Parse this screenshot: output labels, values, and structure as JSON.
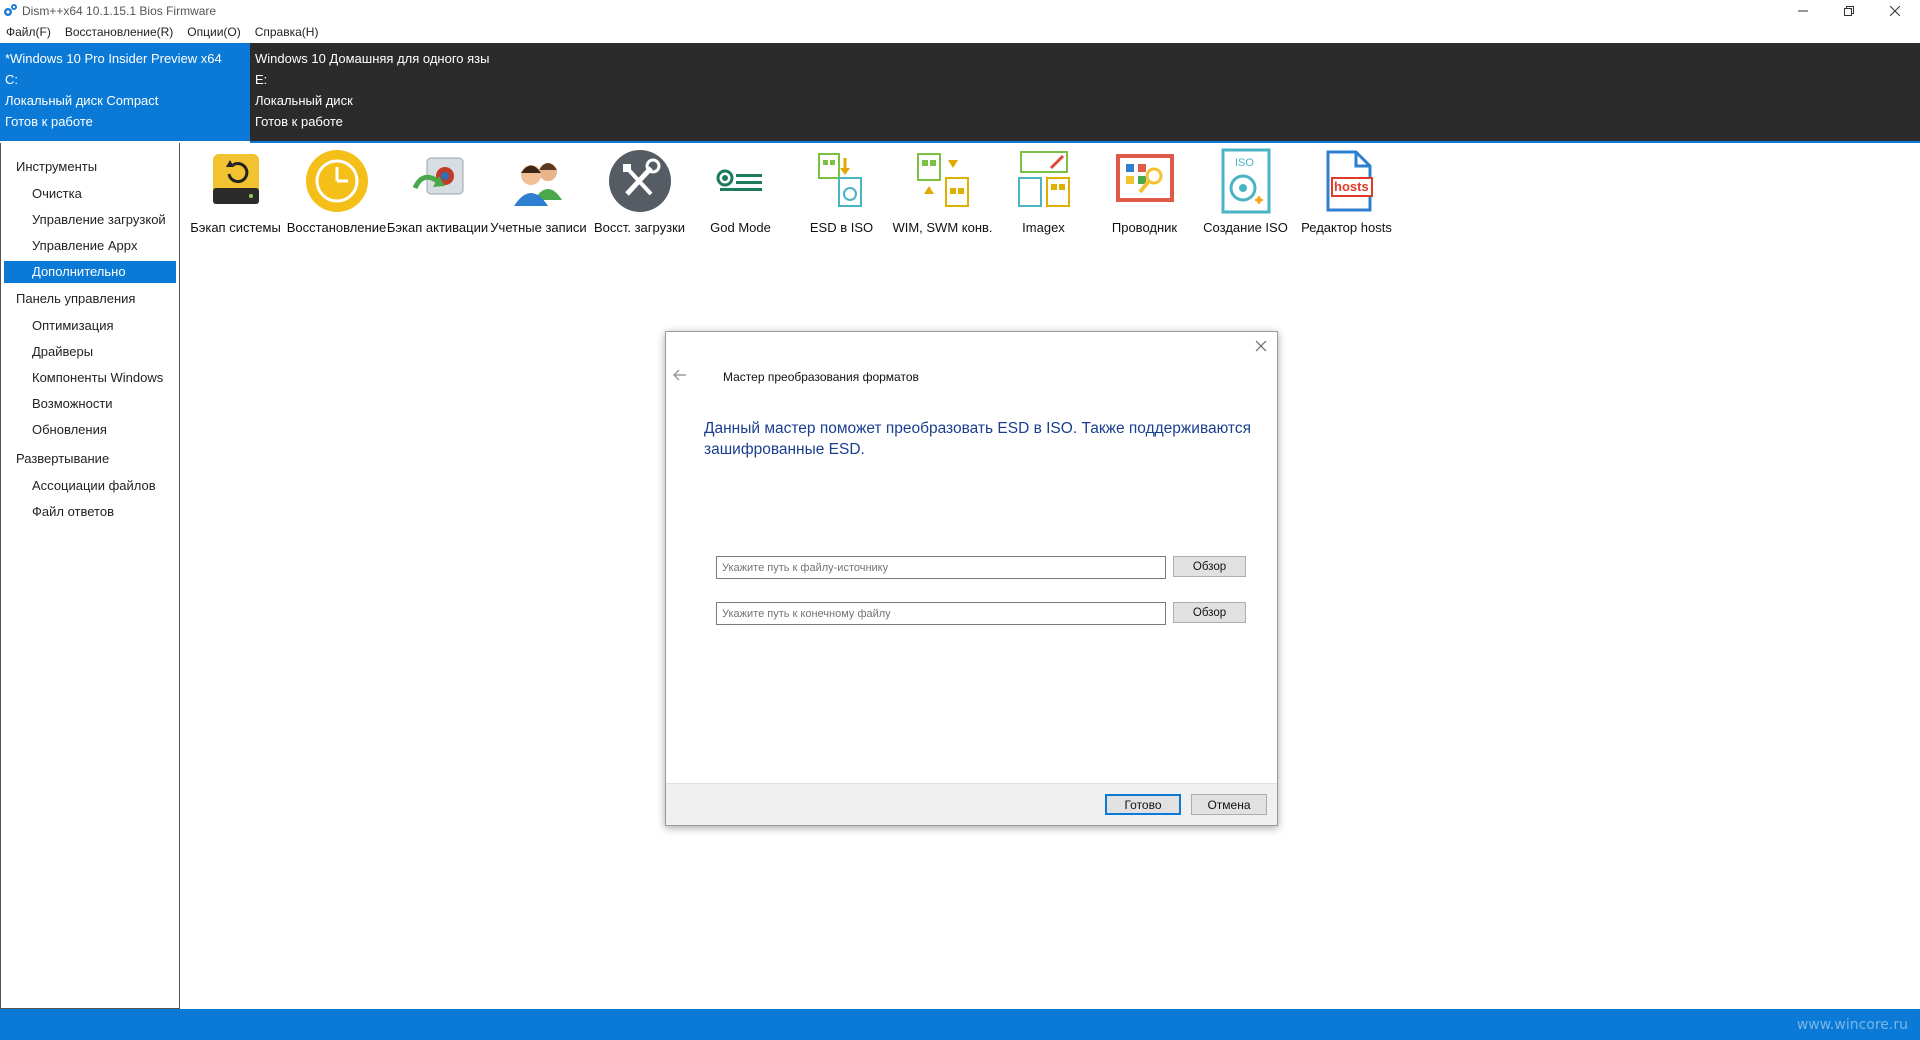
{
  "window": {
    "title": "Dism++x64 10.1.15.1 Bios Firmware"
  },
  "menu": [
    "Файл(F)",
    "Восстановление(R)",
    "Опции(O)",
    "Справка(H)"
  ],
  "header": {
    "left": [
      "*Windows 10 Pro Insider Preview x64",
      "C:",
      "Локальный диск Compact",
      "Готов к работе"
    ],
    "right": [
      "Windows 10 Домашняя для одного язы",
      "E:",
      "Локальный диск",
      "Готов к работе"
    ]
  },
  "sidebar": {
    "sections": [
      {
        "title": "Инструменты",
        "items": [
          "Очистка",
          "Управление загрузкой",
          "Управление Appx",
          "Дополнительно"
        ]
      },
      {
        "title": "Панель управления",
        "items": [
          "Оптимизация",
          "Драйверы",
          "Компоненты Windows",
          "Возможности",
          "Обновления"
        ]
      },
      {
        "title": "Развертывание",
        "items": [
          "Ассоциации файлов",
          "Файл ответов"
        ]
      }
    ],
    "active_item": "Дополнительно"
  },
  "toolbar": [
    {
      "label": "Бэкап системы",
      "icon": "system-backup-icon"
    },
    {
      "label": "Восстановление",
      "icon": "restore-clock-icon"
    },
    {
      "label": "Бэкап активации",
      "icon": "activation-backup-icon"
    },
    {
      "label": "Учетные записи",
      "icon": "user-accounts-icon"
    },
    {
      "label": "Восст. загрузки",
      "icon": "boot-repair-icon"
    },
    {
      "label": "God Mode",
      "icon": "god-mode-icon"
    },
    {
      "label": "ESD в ISO",
      "icon": "esd-to-iso-icon"
    },
    {
      "label": "WIM, SWM конв.",
      "icon": "wim-swm-convert-icon"
    },
    {
      "label": "Imagex",
      "icon": "imagex-icon"
    },
    {
      "label": "Проводник",
      "icon": "explorer-icon"
    },
    {
      "label": "Создание ISO",
      "icon": "iso-create-icon"
    },
    {
      "label": "Редактор hosts",
      "icon": "hosts-editor-icon",
      "icon_text": "hosts"
    }
  ],
  "dialog": {
    "title": "Мастер преобразования форматов",
    "description": "Данный мастер поможет преобразовать ESD в ISO. Также поддерживаются зашифрованные ESD.",
    "source_placeholder": "Укажите путь к файлу-источнику",
    "dest_placeholder": "Укажите путь к конечному файлу",
    "browse_label": "Обзор",
    "ok_label": "Готово",
    "cancel_label": "Отмена"
  },
  "status": {
    "watermark": "www.wincore.ru"
  },
  "colors": {
    "accent": "#0a7ad6",
    "dark_panel": "#2b2b2b",
    "dialog_text": "#1a3f8f"
  }
}
